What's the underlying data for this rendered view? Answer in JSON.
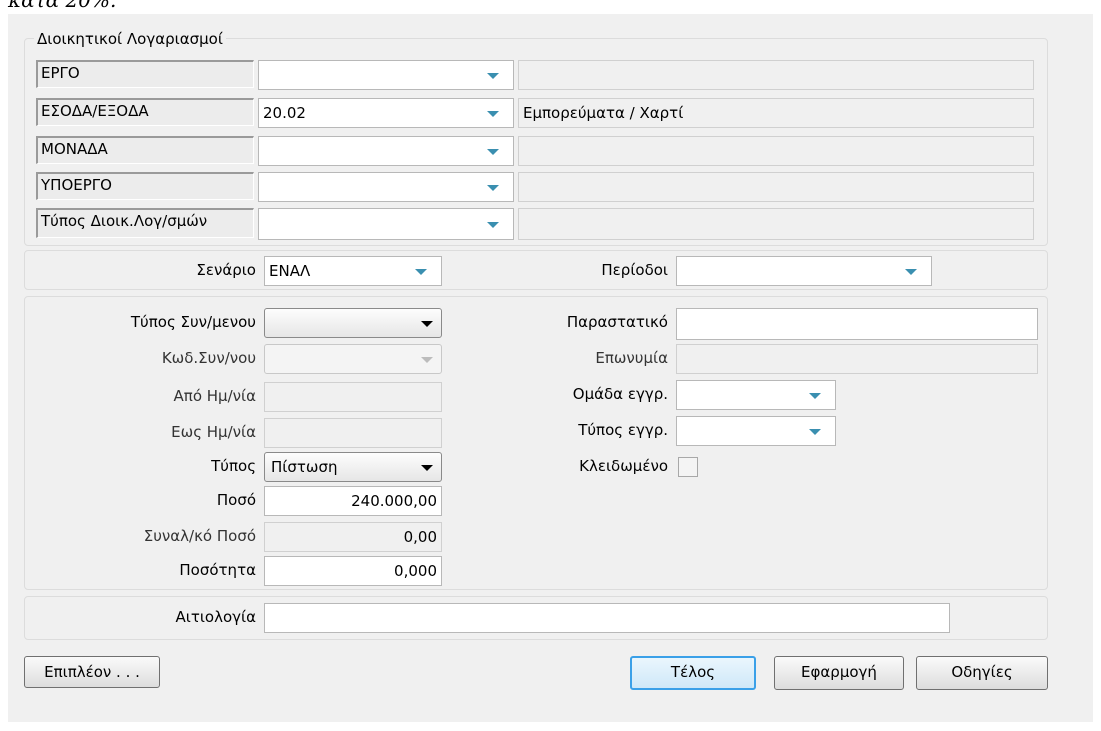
{
  "top_fragment": "κατά 20%.",
  "admin_accounts": {
    "legend": "Διοικητικοί Λογαριασμοί",
    "rows": [
      {
        "label": "ΕΡΓΟ",
        "value": "",
        "description": ""
      },
      {
        "label": "ΕΣΟΔΑ/ΕΞΟΔΑ",
        "value": "20.02",
        "description": "Εμπορεύματα / Χαρτί"
      },
      {
        "label": "ΜΟΝΑΔΑ",
        "value": "",
        "description": ""
      },
      {
        "label": "ΥΠΟΕΡΓΟ",
        "value": "",
        "description": ""
      },
      {
        "label": "Τύπος Διοικ.Λογ/σμών",
        "value": "",
        "description": ""
      }
    ]
  },
  "scenario": {
    "label": "Σενάριο",
    "value": "ΕΝΑΛ"
  },
  "periods": {
    "label": "Περίοδοι",
    "value": ""
  },
  "details": {
    "entity_type_label": "Τύπος Συν/μενου",
    "entity_type_value": "",
    "entity_code_label": "Κωδ.Συν/νου",
    "entity_code_value": "",
    "from_date_label": "Από Ημ/νία",
    "from_date_value": "",
    "to_date_label": "Εως Ημ/νία",
    "to_date_value": "",
    "type_label": "Τύπος",
    "type_value": "Πίστωση",
    "amount_label": "Ποσό",
    "amount_value": "240.000,00",
    "fx_amount_label": "Συναλ/κό Ποσό",
    "fx_amount_value": "0,00",
    "quantity_label": "Ποσότητα",
    "quantity_value": "0,000",
    "document_label": "Παραστατικό",
    "document_value": "",
    "name_label": "Επωνυμία",
    "name_value": "",
    "entry_group_label": "Ομάδα εγγρ.",
    "entry_group_value": "",
    "entry_type_label": "Τύπος εγγρ.",
    "entry_type_value": "",
    "locked_label": "Κλειδωμένο",
    "locked": false
  },
  "reason": {
    "label": "Αιτιολογία",
    "value": ""
  },
  "buttons": {
    "more": "Επιπλέον . . .",
    "ok": "Τέλος",
    "apply": "Εφαρμογή",
    "help": "Οδηγίες"
  },
  "colors": {
    "dropdown_arrow": "#3a8fb0",
    "default_button_border": "#3aa0e8"
  }
}
